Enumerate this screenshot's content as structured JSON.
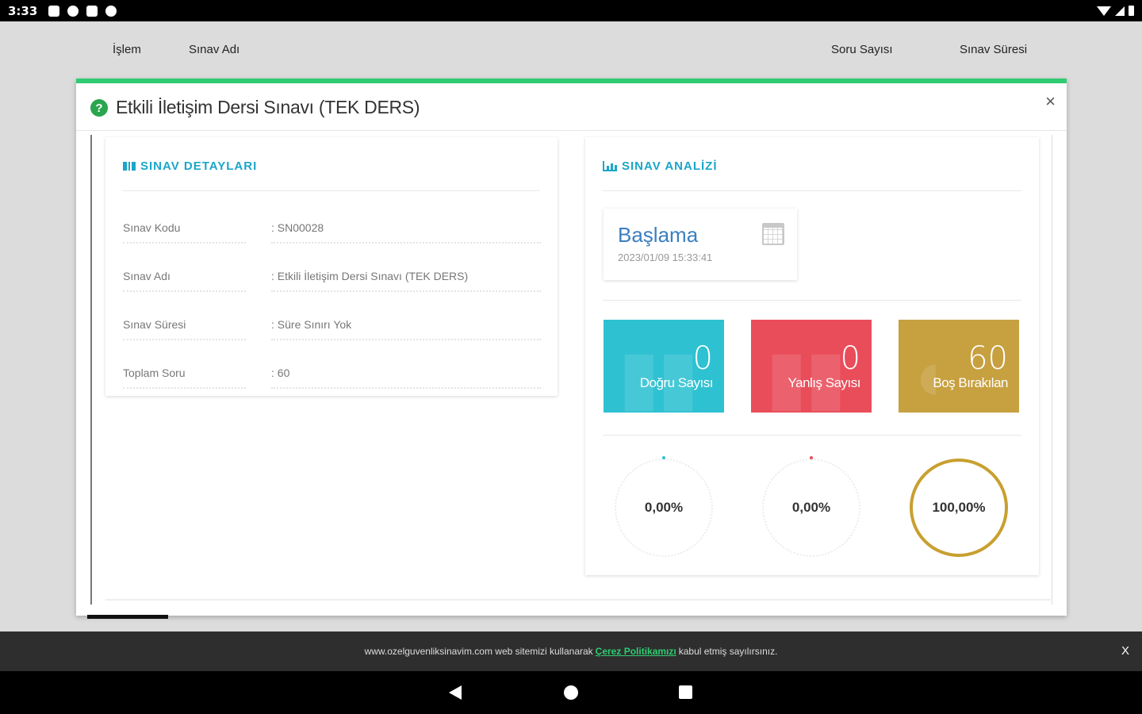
{
  "status_bar": {
    "time": "3:33"
  },
  "background_table": {
    "columns": [
      "İşlem",
      "Sınav Adı",
      "Soru Sayısı",
      "Sınav Süresi"
    ]
  },
  "modal": {
    "title": "Etkili İletişim Dersi Sınavı (TEK DERS)",
    "close_label": "×",
    "details": {
      "heading": "SINAV DETAYLARI",
      "rows": [
        {
          "label": "Sınav Kodu",
          "value": ": SN00028"
        },
        {
          "label": "Sınav Adı",
          "value": ": Etkili İletişim Dersi Sınavı (TEK DERS)"
        },
        {
          "label": "Sınav Süresi",
          "value": ": Süre Sınırı Yok"
        },
        {
          "label": "Toplam Soru",
          "value": ": 60"
        }
      ]
    },
    "analysis": {
      "heading": "SINAV ANALİZİ",
      "start": {
        "label": "Başlama",
        "date": "2023/01/09 15:33:41"
      },
      "stats": [
        {
          "value": "0",
          "label": "Doğru Sayısı",
          "color": "#2ec1d2"
        },
        {
          "value": "0",
          "label": "Yanlış Sayısı",
          "color": "#e94d5a"
        },
        {
          "value": "60",
          "label": "Boş Bırakılan",
          "color": "#c7a040"
        }
      ],
      "gauges": [
        {
          "text": "0,00%",
          "percent": 0,
          "color": "#2ec1d2"
        },
        {
          "text": "0,00%",
          "percent": 0,
          "color": "#e94d5a"
        },
        {
          "text": "100,00%",
          "percent": 100,
          "color": "#c8a030"
        }
      ]
    }
  },
  "cookie_bar": {
    "text_before": "www.ozelguvenliksinavim.com web sitemizi kullanarak",
    "link": "Çerez Politikamızı",
    "text_after": "kabul etmiş sayılırsınız.",
    "close_label": "X"
  }
}
